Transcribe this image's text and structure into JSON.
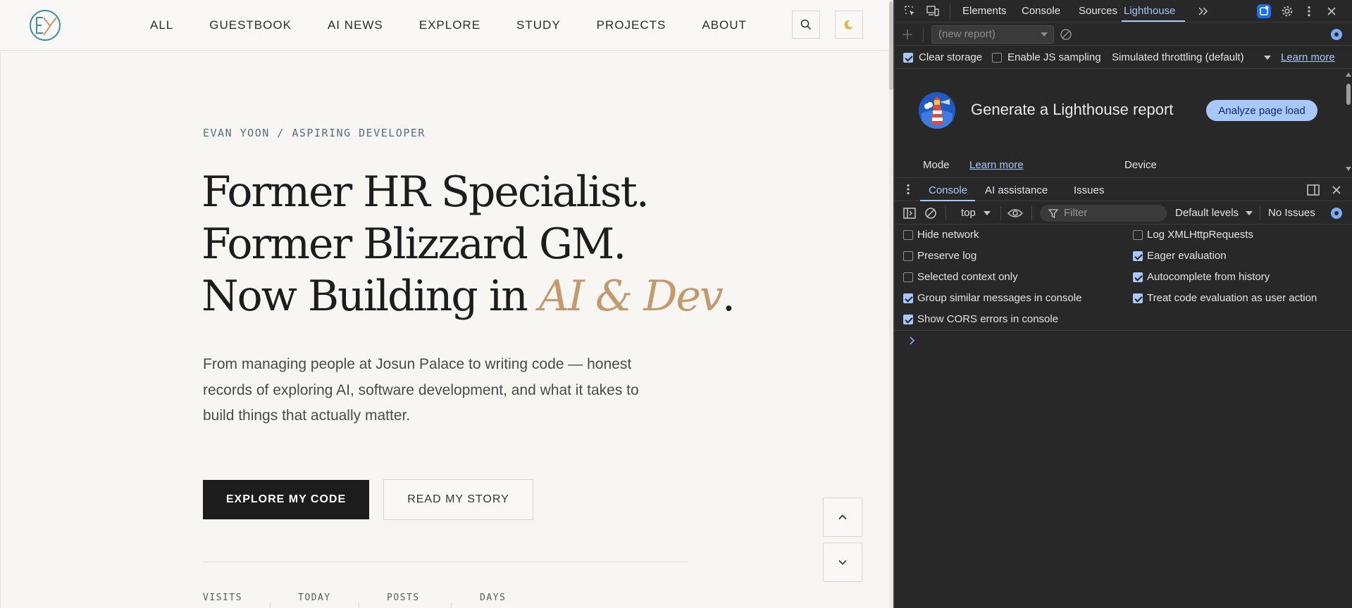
{
  "site": {
    "logo_text": "EY",
    "nav": [
      "ALL",
      "GUESTBOOK",
      "AI NEWS",
      "EXPLORE",
      "STUDY",
      "PROJECTS",
      "ABOUT"
    ],
    "kicker": "EVAN YOON / ASPIRING DEVELOPER",
    "headline": {
      "line1": "Former HR Specialist.",
      "line2": "Former Blizzard GM.",
      "line3_prefix": "Now Building in ",
      "line3_accent": "AI & Dev",
      "line3_suffix": "."
    },
    "lede": "From managing people at Josun Palace to writing code — honest records of exploring AI, software development, and what it takes to build things that actually matter.",
    "buttons": {
      "primary": "EXPLORE MY CODE",
      "secondary": "READ MY STORY"
    },
    "stats": [
      "VISITS",
      "TODAY",
      "POSTS",
      "DAYS"
    ],
    "colors": {
      "accent": "#c49a6c",
      "kicker": "#546e82",
      "background": "#f7f6f3"
    }
  },
  "devtools": {
    "tabs": [
      "Elements",
      "Console",
      "Sources",
      "Lighthouse"
    ],
    "active_tab": "Lighthouse",
    "report_select": "(new report)",
    "options": {
      "clear_storage": "Clear storage",
      "js_sampling": "Enable JS sampling",
      "throttling": "Simulated throttling (default)",
      "learn_more": "Learn more"
    },
    "lighthouse": {
      "title": "Generate a Lighthouse report",
      "analyze": "Analyze page load",
      "mode": "Mode",
      "mode_learn_more": "Learn more",
      "device": "Device"
    },
    "drawer_tabs": [
      "Console",
      "AI assistance",
      "Issues"
    ],
    "console_toolbar": {
      "context": "top",
      "filter_placeholder": "Filter",
      "levels": "Default levels",
      "issues": "No Issues"
    },
    "console_settings": [
      {
        "label": "Hide network",
        "checked": false
      },
      {
        "label": "Log XMLHttpRequests",
        "checked": false
      },
      {
        "label": "Preserve log",
        "checked": false
      },
      {
        "label": "Eager evaluation",
        "checked": true
      },
      {
        "label": "Selected context only",
        "checked": false
      },
      {
        "label": "Autocomplete from history",
        "checked": true
      },
      {
        "label": "Group similar messages in console",
        "checked": true
      },
      {
        "label": "Treat code evaluation as user action",
        "checked": true
      },
      {
        "label": "Show CORS errors in console",
        "checked": true
      }
    ],
    "lh_checkboxes": {
      "clear_storage": true,
      "js_sampling": false
    },
    "colors": {
      "panel_bg": "#282828",
      "accent": "#a8c7fa",
      "lighthouse_blue": "#1f5bc2",
      "lighthouse_red": "#e2483a"
    }
  }
}
